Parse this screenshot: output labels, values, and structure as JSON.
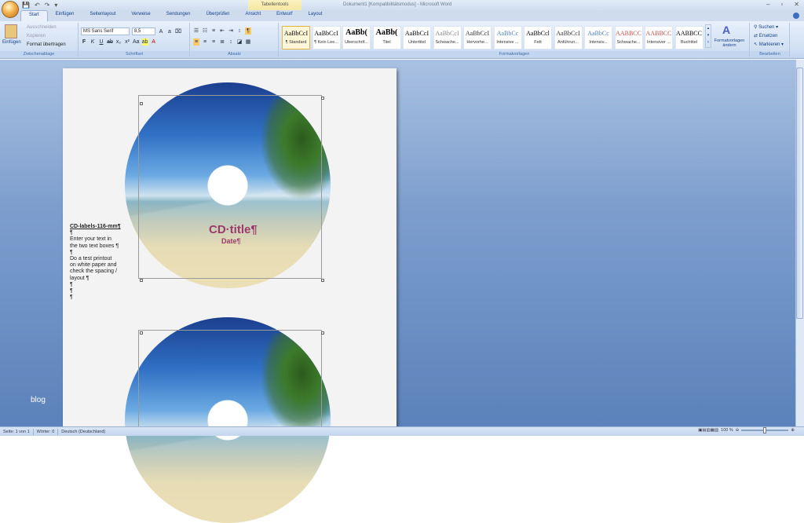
{
  "window": {
    "title": "Dokument1 [Kompatibilitätsmodus] - Microsoft Word",
    "context_tab": "Tabellentools"
  },
  "tabs": [
    "Start",
    "Einfügen",
    "Seitenlayout",
    "Verweise",
    "Sendungen",
    "Überprüfen",
    "Ansicht",
    "Entwurf",
    "Layout"
  ],
  "clipboard": {
    "paste": "Einfügen",
    "cut": "Ausschneiden",
    "copy": "Kopieren",
    "format_painter": "Format übertragen",
    "label": "Zwischenablage"
  },
  "font": {
    "name": "MS Sans Serif",
    "size": "8,5",
    "label": "Schriftart"
  },
  "paragraph": {
    "label": "Absatz"
  },
  "styles": {
    "label": "Formatvorlagen",
    "change": "Formatvorlagen ändern",
    "items": [
      {
        "sample": "AaBbCcI",
        "name": "¶ Standard"
      },
      {
        "sample": "AaBbCcI",
        "name": "¶ Kein Lee..."
      },
      {
        "sample": "AaBb(",
        "name": "Überschrif..."
      },
      {
        "sample": "AaBb(",
        "name": "Titel"
      },
      {
        "sample": "AaBbCcI",
        "name": "Untertitel"
      },
      {
        "sample": "AaBbCcI",
        "name": "Schwache..."
      },
      {
        "sample": "AaBbCcI",
        "name": "Hervorhe..."
      },
      {
        "sample": "AaBbCc",
        "name": "Intensive ..."
      },
      {
        "sample": "AaBbCcl",
        "name": "Fett"
      },
      {
        "sample": "AaBbCcI",
        "name": "Anführun..."
      },
      {
        "sample": "AaBbCc",
        "name": "Intensiv..."
      },
      {
        "sample": "AABBCC",
        "name": "Schwache..."
      },
      {
        "sample": "AABBCC",
        "name": "Intensiver ..."
      },
      {
        "sample": "AABBCC",
        "name": "Buchtitel"
      }
    ]
  },
  "editing": {
    "find": "Suchen",
    "replace": "Ersetzen",
    "select": "Markieren",
    "label": "Bearbeiten"
  },
  "document": {
    "side_lines": [
      "CD-labels-116-mm¶",
      "¶",
      "Enter your text in",
      "the two text boxes ¶",
      "¶",
      "Do a test printout",
      "on white paper and",
      "check the spacing /",
      "layout ¶",
      "¶",
      "¶",
      "¶"
    ],
    "cd_title": "CD·title¶",
    "cd_date": "Date¶"
  },
  "watermark": "blog",
  "status": {
    "page": "Seite: 1 von 1",
    "words": "Wörter: 0",
    "language": "Deutsch (Deutschland)",
    "zoom": "100 %"
  }
}
